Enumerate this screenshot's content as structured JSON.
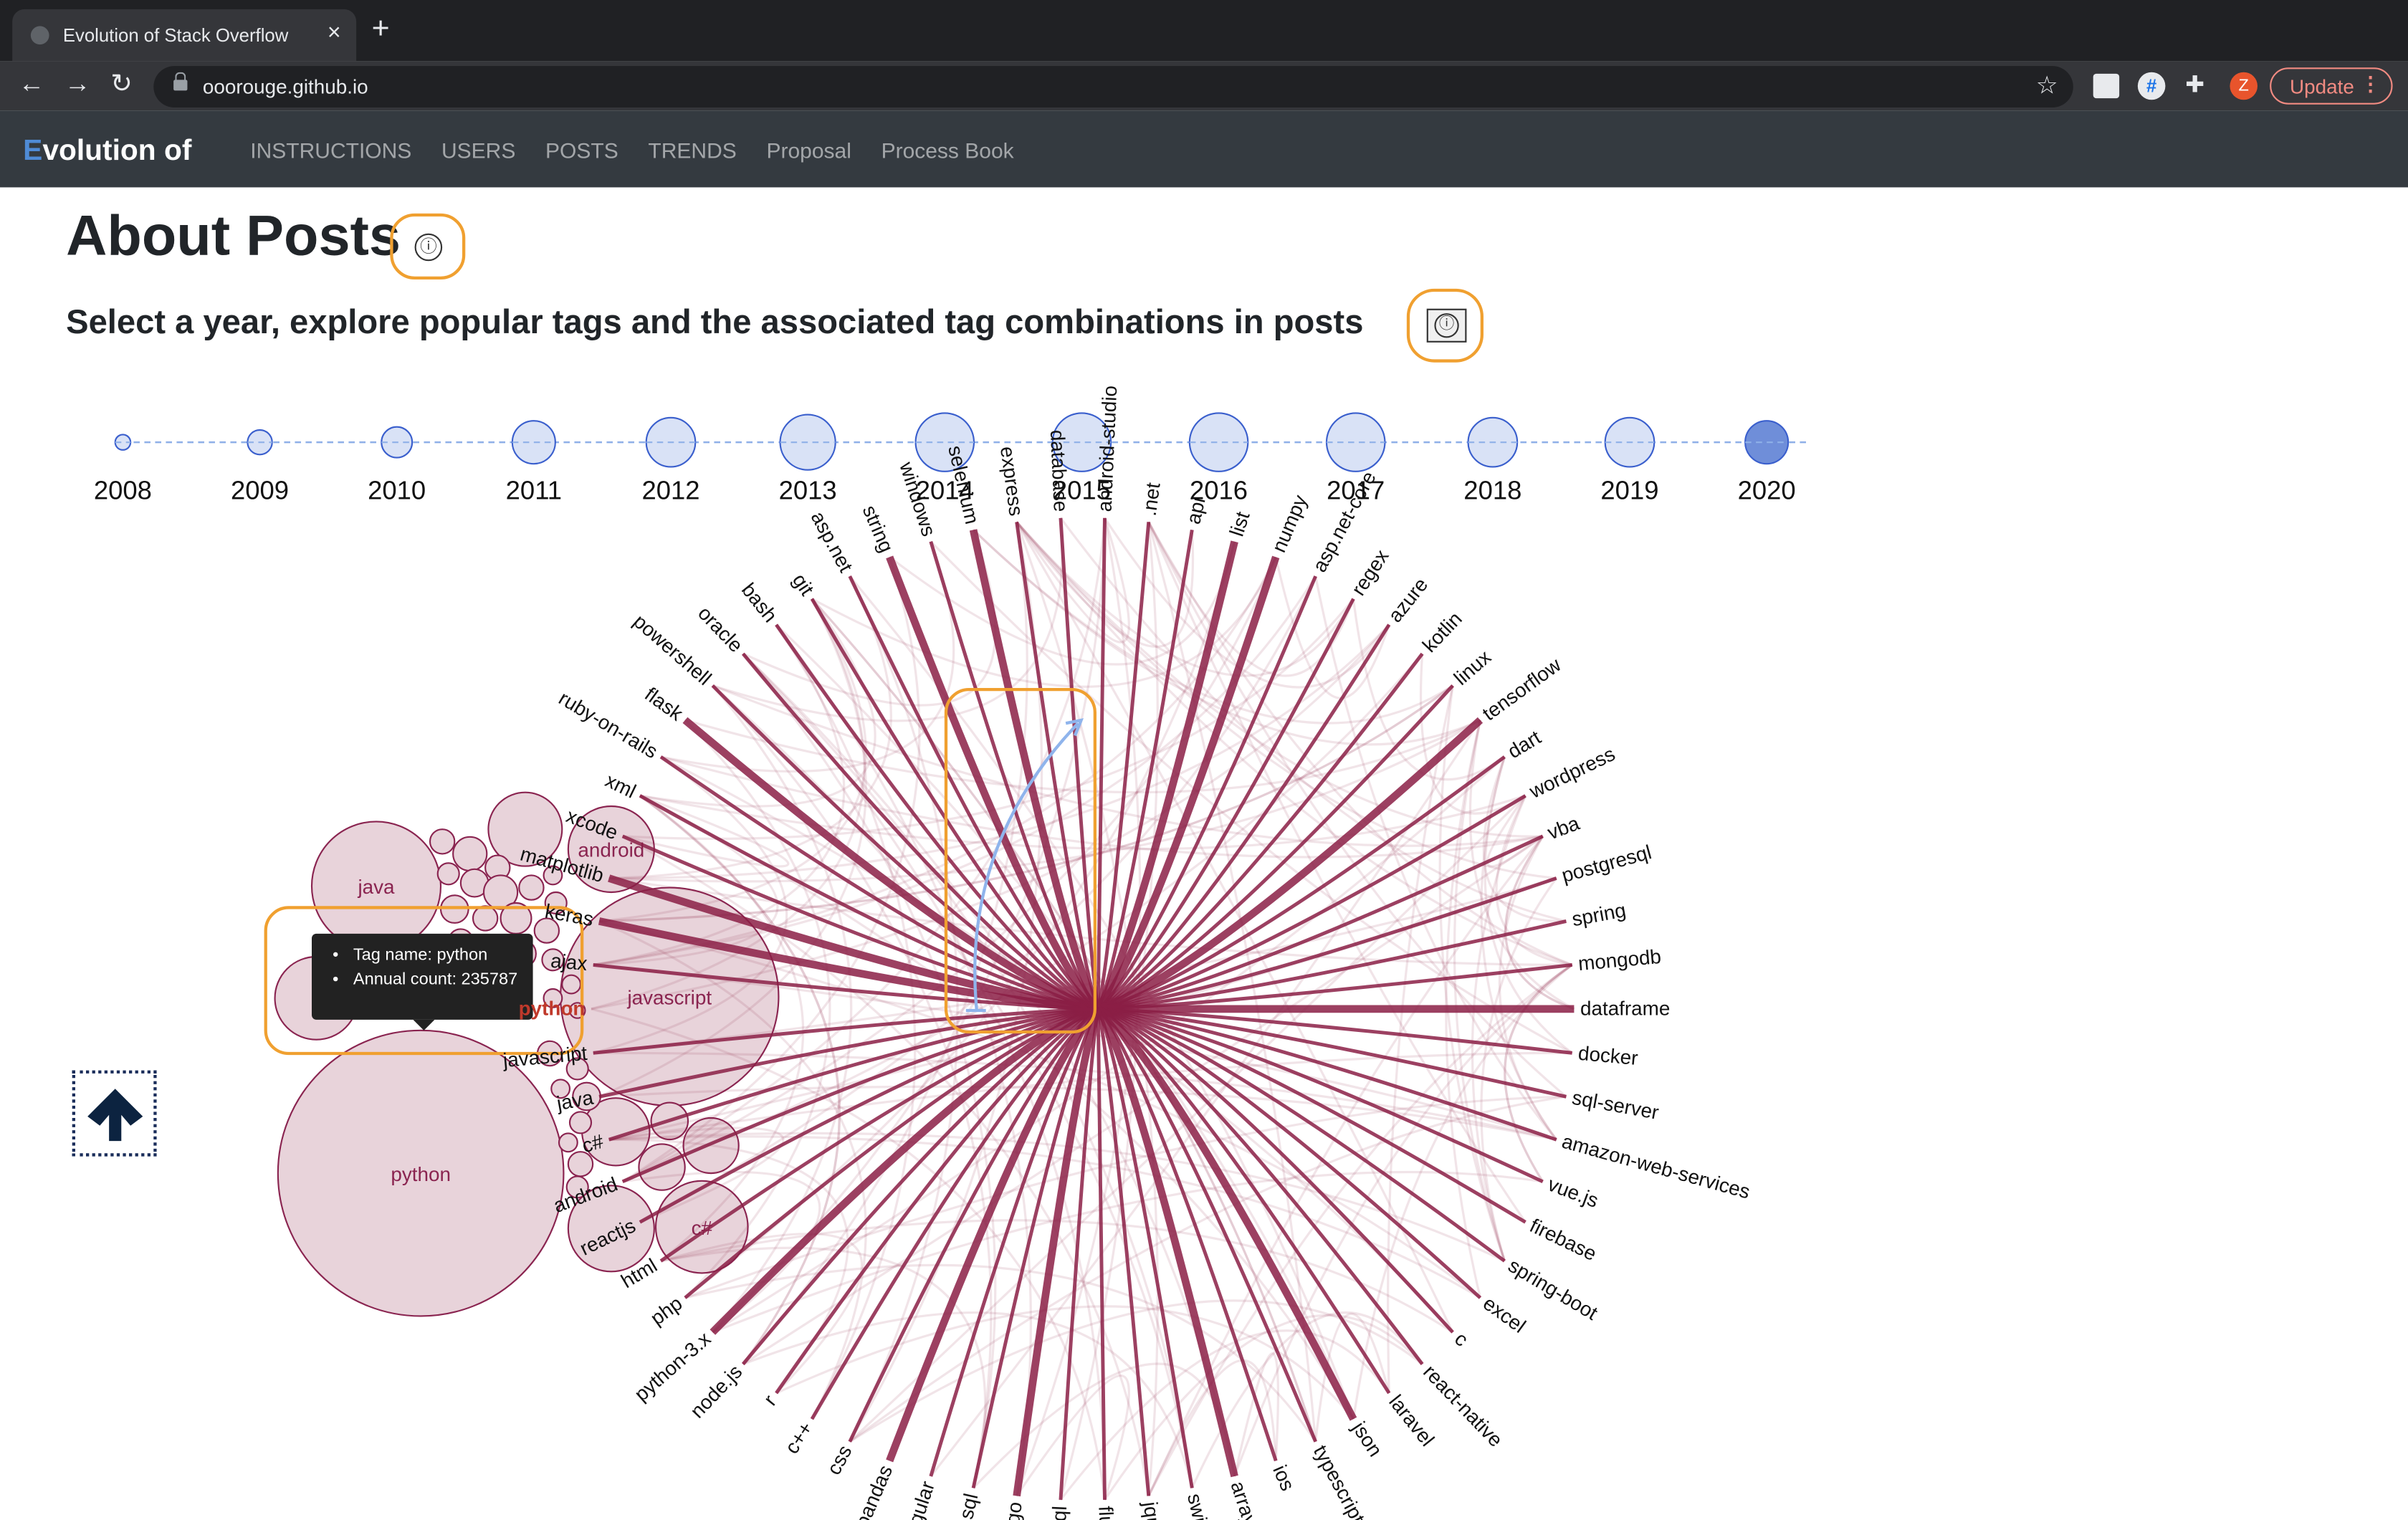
{
  "browser": {
    "tab_title": "Evolution of Stack Overflow",
    "url": "ooorouge.github.io",
    "update_label": "Update",
    "profile_initial": "Z",
    "ext_icon_text": "#"
  },
  "site": {
    "brand_first": "E",
    "brand_rest": "volution of",
    "nav": [
      "INSTRUCTIONS",
      "USERS",
      "POSTS",
      "TRENDS",
      "Proposal",
      "Process Book"
    ]
  },
  "page": {
    "title": "About Posts",
    "subtitle": "Select a year, explore popular tags and the associated tag combinations in posts",
    "info_glyph": "ⓘ"
  },
  "timeline": {
    "years": [
      "2008",
      "2009",
      "2010",
      "2011",
      "2012",
      "2013",
      "2014",
      "2015",
      "2016",
      "2017",
      "2018",
      "2019",
      "2020"
    ],
    "selected": "2020"
  },
  "bubbles": {
    "labels": {
      "java": "java",
      "android": "android",
      "javascript": "javascript",
      "python": "python",
      "csharp": "c#"
    },
    "tooltip": {
      "tag": "Tag name: python",
      "count": "Annual count: 235787"
    }
  },
  "chord": {
    "selected_tag": "python",
    "tags": [
      "python",
      "ajax",
      "keras",
      "matplotlib",
      "xcode",
      "xml",
      "ruby-on-rails",
      "flask",
      "powershell",
      "oracle",
      "bash",
      "git",
      "asp.net",
      "string",
      "windows",
      "selenium",
      "express",
      "database",
      "android-studio",
      ".net",
      "api",
      "list",
      "numpy",
      "asp.net-core",
      "regex",
      "azure",
      "kotlin",
      "linux",
      "tensorflow",
      "dart",
      "wordpress",
      "vba",
      "postgresql",
      "spring",
      "mongodb",
      "dataframe",
      "docker",
      "sql-server",
      "amazon-web-services",
      "vue.js",
      "firebase",
      "spring-boot",
      "excel",
      "c",
      "react-native",
      "laravel",
      "json",
      "typescript",
      "ios",
      "arrays",
      "swift",
      "jquery",
      "flutter",
      "mysql",
      "django",
      "sql",
      "angular",
      "pandas",
      "css",
      "c++",
      "r",
      "node.js",
      "python-3.x",
      "php",
      "html",
      "reactjs",
      "android",
      "c#",
      "java",
      "javascript"
    ],
    "strong_tags": [
      "pandas",
      "django",
      "dataframe",
      "numpy",
      "flask",
      "list",
      "python-3.x",
      "tensorflow",
      "keras",
      "matplotlib",
      "selenium",
      "json",
      "arrays",
      "string"
    ]
  },
  "colors": {
    "accent": "#f0a030",
    "chord": "#8b1e45",
    "bubble_fill": "#e8d3da",
    "bubble_stroke": "#8a2450",
    "timeline": "#3a5fcd"
  }
}
